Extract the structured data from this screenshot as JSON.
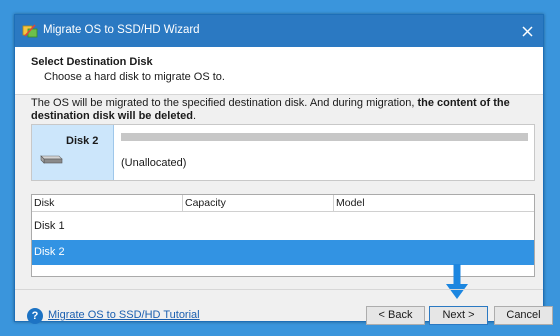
{
  "window": {
    "title": "Migrate OS to SSD/HD Wizard"
  },
  "header": {
    "title": "Select Destination Disk",
    "subtitle": "Choose a hard disk to migrate OS to."
  },
  "warning": {
    "text_plain": "The OS will be migrated to the specified destination disk. And during migration, ",
    "text_bold": "the content of the destination disk will be deleted",
    "text_end": "."
  },
  "disk_card": {
    "name": "Disk 2",
    "partition_label": "(Unallocated)"
  },
  "table": {
    "columns": [
      "Disk",
      "Capacity",
      "Model"
    ],
    "rows": [
      {
        "disk": "Disk 1",
        "capacity": "",
        "model": "",
        "selected": false
      },
      {
        "disk": "Disk 2",
        "capacity": "",
        "model": "",
        "selected": true
      }
    ]
  },
  "footer": {
    "help_link": "Migrate OS to SSD/HD Tutorial",
    "back_label": "< Back",
    "next_label": "Next >",
    "cancel_label": "Cancel"
  },
  "colors": {
    "background": "#3a95dc",
    "titlebar": "#2b79c2",
    "selection": "#3293e3",
    "arrow": "#1c86e0"
  },
  "icons": {
    "app": "migrate-wizard-icon",
    "close": "close-icon",
    "disk": "hard-disk-icon",
    "help": "question-circle-icon",
    "pointer": "down-arrow-icon"
  }
}
